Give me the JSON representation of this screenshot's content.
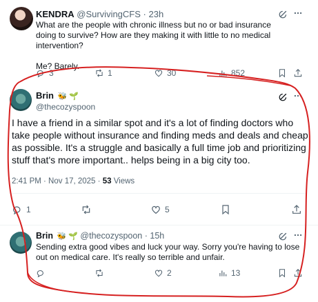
{
  "colors": {
    "text": "#0f1419",
    "muted": "#536471",
    "annotation": "#d62020",
    "sprout": "#45a82c"
  },
  "tweet_kendra": {
    "name": "KENDRA",
    "handle": "@SurvivingCFS",
    "time": "· 23h",
    "body": [
      "What are the people with chronic illness but no or bad insurance doing to survive? How are they making it with little to no medical intervention?",
      "Me? Barely."
    ],
    "actions": {
      "replies": "3",
      "reposts": "1",
      "likes": "30",
      "views": "852"
    }
  },
  "tweet_brin": {
    "name": "Brin",
    "badges": "🐝 🌱",
    "handle": "@thecozyspoon",
    "body": "I have a friend in a similar spot and it's a lot of finding doctors who take people without insurance and finding meds and deals and cheap as possible. It's a struggle and basically a full time job and prioritizing stuff that's more  important.. helps being in a big city too.",
    "timestamp": "2:41 PM · Nov 17, 2025 ·",
    "views_count": "53",
    "views_label": "Views",
    "actions": {
      "replies": "1",
      "reposts": "",
      "likes": "5"
    }
  },
  "tweet_reply": {
    "name": "Brin",
    "badges": "🐝 🌱",
    "handle": "@thecozyspoon",
    "time": "· 15h",
    "body": "Sending extra good vibes and luck your way. Sorry you're having to lose out on medical care. It's really so terrible and unfair.",
    "actions": {
      "replies": "",
      "reposts": "",
      "likes": "2",
      "views": "13"
    }
  }
}
